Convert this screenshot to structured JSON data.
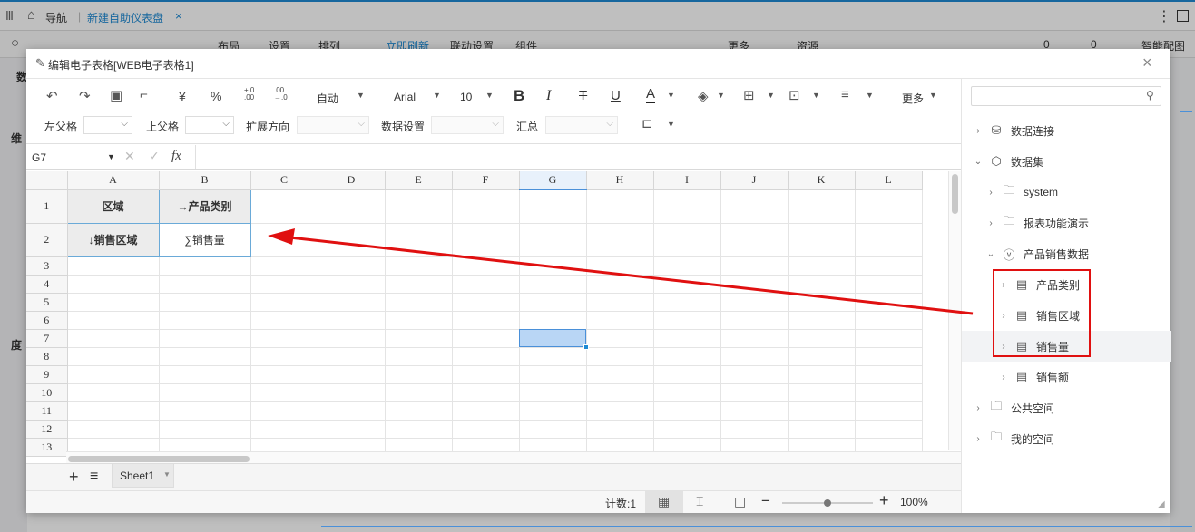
{
  "nav": {
    "menu_icon": "menu-icon",
    "home_label": "导航",
    "tab_title": "新建自助仪表盘",
    "close_symbol": "×"
  },
  "topbar": {
    "items": [
      "布局",
      "设置",
      "排列",
      "立即刷新",
      "联动设置",
      "组件",
      "更多",
      "资源"
    ],
    "right": {
      "comment_count": "0",
      "like_count": "0",
      "smart_label": "智能配图"
    }
  },
  "left_labels": {
    "a": "数",
    "b": "维",
    "c": "度"
  },
  "dialog": {
    "title": "编辑电子表格[WEB电子表格1]",
    "close": "×",
    "toolbar": {
      "currency": "¥",
      "percent": "%",
      "inc_dec": "+.0\n.00",
      "dec_dec": ".00\n→.0",
      "auto": "自动",
      "font": "Arial",
      "size": "10",
      "bold": "B",
      "italic": "I",
      "strike": "T",
      "underline": "U",
      "fontcolor": "A",
      "more": "更多",
      "left_parent": "左父格",
      "up_parent": "上父格",
      "expand": "扩展方向",
      "data_setting": "数据设置",
      "summary": "汇总"
    },
    "formula": {
      "cell_ref": "G7",
      "fx": "fx",
      "value": ""
    },
    "columns": [
      "A",
      "B",
      "C",
      "D",
      "E",
      "F",
      "G",
      "H",
      "I",
      "J",
      "K",
      "L"
    ],
    "rows": [
      "1",
      "2",
      "3",
      "4",
      "5",
      "6",
      "7",
      "8",
      "9",
      "10",
      "11",
      "12",
      "13"
    ],
    "cells": {
      "A1": "区域",
      "B1": "→产品类别",
      "A2": "↓销售区域",
      "B2": "∑销售量"
    },
    "sheet": {
      "add": "+",
      "list": "≡",
      "name": "Sheet1"
    },
    "status": {
      "count": "计数:1",
      "zoom": "100%"
    }
  },
  "right_panel": {
    "search_placeholder": "",
    "tree": [
      {
        "label": "数据连接",
        "icon": "database-settings-icon",
        "level": 0,
        "expand": "collapsed"
      },
      {
        "label": "数据集",
        "icon": "cube-icon",
        "level": 0,
        "expand": "expanded"
      },
      {
        "label": "system",
        "icon": "folder-icon",
        "level": 1,
        "expand": "collapsed"
      },
      {
        "label": "报表功能演示",
        "icon": "folder-icon",
        "level": 1,
        "expand": "collapsed"
      },
      {
        "label": "产品销售数据",
        "icon": "query-icon",
        "level": 1,
        "expand": "expanded"
      },
      {
        "label": "产品类别",
        "icon": "field-icon",
        "level": 2,
        "expand": "collapsed"
      },
      {
        "label": "销售区域",
        "icon": "field-icon",
        "level": 2,
        "expand": "collapsed"
      },
      {
        "label": "销售量",
        "icon": "field-icon",
        "level": 2,
        "expand": "collapsed"
      },
      {
        "label": "销售额",
        "icon": "field-icon",
        "level": 2,
        "expand": "collapsed"
      },
      {
        "label": "公共空间",
        "icon": "folder-icon",
        "level": 0,
        "expand": "collapsed"
      },
      {
        "label": "我的空间",
        "icon": "user-folder-icon",
        "level": 0,
        "expand": "collapsed"
      }
    ]
  },
  "colors": {
    "accent": "#1f8ad3",
    "annotation": "#e01010",
    "selection": "#b9d6f5"
  }
}
